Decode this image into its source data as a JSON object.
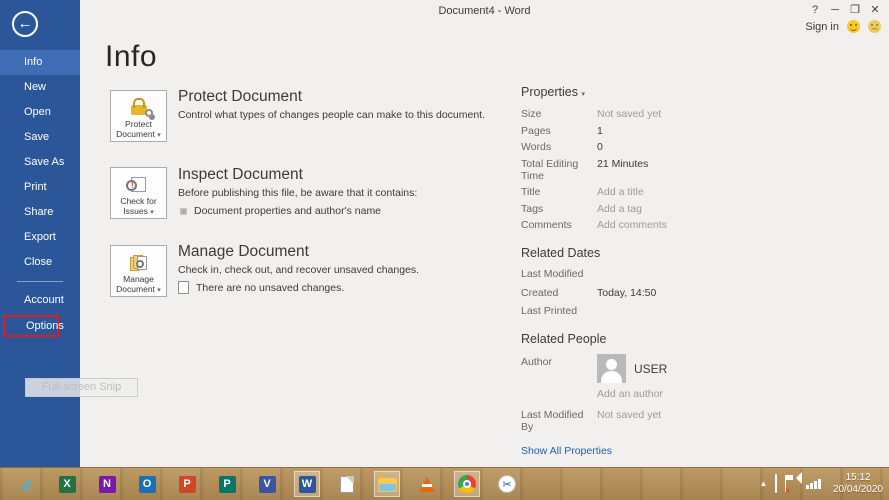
{
  "window": {
    "title": "Document4 - Word",
    "help": "?",
    "minimize": "─",
    "restore": "❐",
    "close": "✕",
    "sign_in": "Sign in",
    "back_arrow": "←"
  },
  "sidebar": {
    "items": [
      {
        "label": "Info",
        "active": true
      },
      {
        "label": "New"
      },
      {
        "label": "Open"
      },
      {
        "label": "Save"
      },
      {
        "label": "Save As"
      },
      {
        "label": "Print"
      },
      {
        "label": "Share"
      },
      {
        "label": "Export"
      },
      {
        "label": "Close"
      },
      {
        "label": "Account"
      },
      {
        "label": "Options",
        "highlighted_with_red_box": true
      }
    ]
  },
  "page": {
    "title": "Info"
  },
  "ui": {
    "caret": "▾"
  },
  "sections": [
    {
      "button_label": "Protect Document",
      "heading": "Protect Document",
      "description": "Control what types of changes people can make to this document."
    },
    {
      "button_label": "Check for Issues",
      "heading": "Inspect Document",
      "description": "Before publishing this file, be aware that it contains:",
      "bullet": "Document properties and author's name"
    },
    {
      "button_label": "Manage Document",
      "heading": "Manage Document",
      "description": "Check in, check out, and recover unsaved changes.",
      "bullet": "There are no unsaved changes."
    }
  ],
  "properties": {
    "header": "Properties",
    "rows": [
      {
        "label": "Size",
        "value": "Not saved yet",
        "muted": true
      },
      {
        "label": "Pages",
        "value": "1"
      },
      {
        "label": "Words",
        "value": "0"
      },
      {
        "label": "Total Editing Time",
        "value": "21 Minutes"
      },
      {
        "label": "Title",
        "value": "Add a title",
        "muted": true
      },
      {
        "label": "Tags",
        "value": "Add a tag",
        "muted": true
      },
      {
        "label": "Comments",
        "value": "Add comments",
        "muted": true
      }
    ]
  },
  "related_dates": {
    "heading": "Related Dates",
    "rows": [
      {
        "label": "Last Modified",
        "value": ""
      },
      {
        "label": "Created",
        "value": "Today, 14:50"
      },
      {
        "label": "Last Printed",
        "value": ""
      }
    ]
  },
  "related_people": {
    "heading": "Related People",
    "author_label": "Author",
    "author_name": "USER",
    "add_author": "Add an author",
    "last_modified_by_label": "Last Modified By",
    "last_modified_by_value": "Not saved yet"
  },
  "show_all_properties": "Show All Properties",
  "tooltip": {
    "text": "Full-screen Snip"
  },
  "taskbar": {
    "apps": [
      {
        "name": "internet-explorer",
        "letter": "e"
      },
      {
        "name": "excel",
        "letter": "X"
      },
      {
        "name": "onenote",
        "letter": "N"
      },
      {
        "name": "outlook",
        "letter": "O"
      },
      {
        "name": "powerpoint",
        "letter": "P"
      },
      {
        "name": "publisher",
        "letter": "P"
      },
      {
        "name": "visio",
        "letter": "V"
      },
      {
        "name": "word",
        "letter": "W",
        "active": true
      },
      {
        "name": "notepad"
      },
      {
        "name": "file-explorer",
        "active": true
      },
      {
        "name": "vlc"
      },
      {
        "name": "chrome",
        "active": true
      },
      {
        "name": "snipping-tool",
        "glyph": "✂"
      }
    ],
    "tray": {
      "time": "15:12",
      "date": "20/04/2020"
    }
  }
}
